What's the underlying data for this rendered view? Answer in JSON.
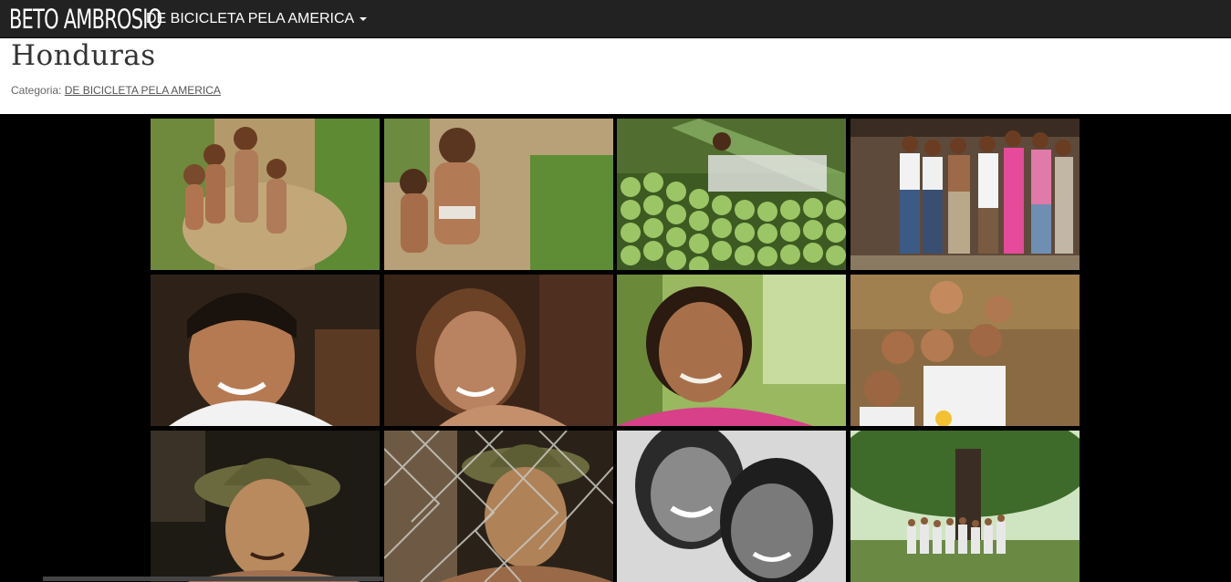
{
  "brand": {
    "name": "BETO AMBROSIO"
  },
  "nav": {
    "menu_label": "DE BICICLETA PELA AMERICA"
  },
  "header": {
    "title": "Honduras",
    "category_prefix": "Categoria:",
    "category_link": "DE BICICLETA PELA AMERICA"
  },
  "gallery": {
    "photos": [
      "children-on-dirt-path",
      "two-children-smiling",
      "man-in-hammock-with-limes",
      "family-group-portrait",
      "smiling-boy",
      "smiling-girl",
      "smiling-elderly-woman",
      "group-of-children",
      "old-man-with-hat",
      "old-man-behind-fence",
      "two-girls-black-and-white",
      "children-under-tree"
    ]
  }
}
